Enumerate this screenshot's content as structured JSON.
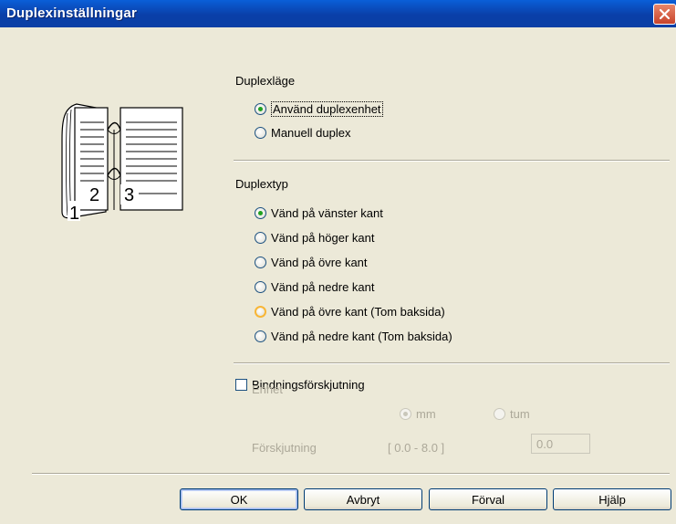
{
  "window": {
    "title": "Duplexinställningar",
    "close_icon": "close-icon"
  },
  "duplex_mode": {
    "label": "Duplexläge",
    "options": [
      {
        "label": "Använd duplexenhet",
        "selected": true
      },
      {
        "label": "Manuell duplex",
        "selected": false
      }
    ]
  },
  "illustration": {
    "icon": "duplex-booklet-icon",
    "page_numbers": [
      "1",
      "2",
      "3"
    ]
  },
  "duplex_type": {
    "label": "Duplextyp",
    "options": [
      {
        "label": "Vänd på vänster kant",
        "selected": true
      },
      {
        "label": "Vänd på höger kant",
        "selected": false
      },
      {
        "label": "Vänd på övre kant",
        "selected": false
      },
      {
        "label": "Vänd på nedre kant",
        "selected": false
      },
      {
        "label": "Vänd på övre kant (Tom baksida)",
        "selected": false
      },
      {
        "label": "Vänd på nedre kant (Tom baksida)",
        "selected": false
      }
    ]
  },
  "binding_offset": {
    "checkbox_label": "Bindningsförskjutning",
    "checked": false,
    "unit_label": "Enhet",
    "units": [
      {
        "label": "mm",
        "selected": true
      },
      {
        "label": "tum",
        "selected": false
      }
    ],
    "offset_label": "Förskjutning",
    "range": "[ 0.0 - 8.0 ]",
    "value": "0.0"
  },
  "buttons": {
    "ok": "OK",
    "cancel": "Avbryt",
    "default": "Förval",
    "help": "Hjälp"
  }
}
